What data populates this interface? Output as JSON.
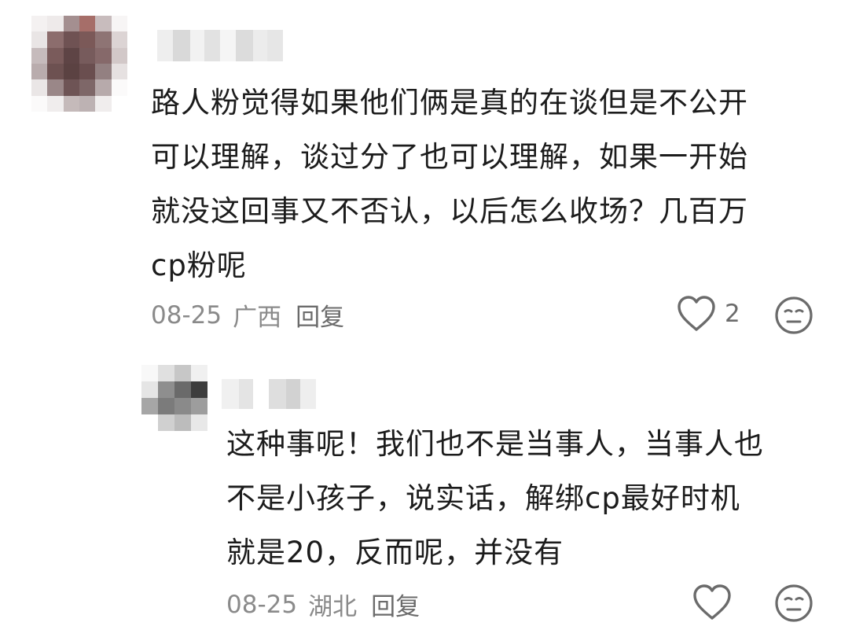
{
  "comments": [
    {
      "text": "路人粉觉得如果他们俩是真的在谈但是不公开可以理解，谈过分了也可以理解，如果一开始就没这回事又不否认，以后怎么收场？几百万cp粉呢",
      "date": "08-25",
      "region": "广西",
      "reply_label": "回复",
      "like_count": "2",
      "like_icon": "heart-outline-icon",
      "emoji_icon": "neutral-face-icon"
    },
    {
      "text": "这种事呢！我们也不是当事人，当事人也不是小孩子，说实话，解绑cp最好时机就是20，反而呢，并没有",
      "date": "08-25",
      "region": "湖北",
      "reply_label": "回复",
      "like_icon": "heart-outline-icon",
      "emoji_icon": "neutral-face-icon"
    }
  ],
  "colors": {
    "text": "#1c1c1c",
    "meta": "#8a8a8a",
    "icon": "#6b6b6b"
  }
}
